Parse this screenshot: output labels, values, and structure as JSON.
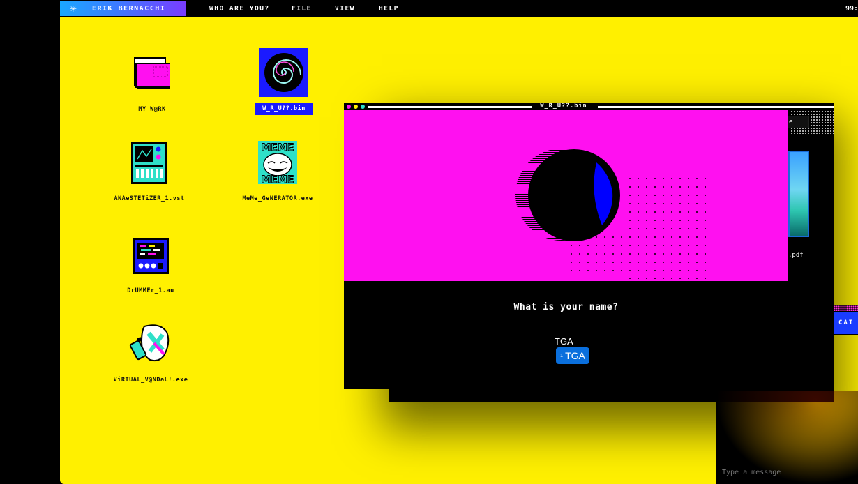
{
  "menubar": {
    "brand": "ERIK BERNACCHI",
    "items": [
      "WHO ARE YOU?",
      "FILE",
      "VIEW",
      "HELP"
    ],
    "clock": "99:"
  },
  "desktop": {
    "icons": [
      {
        "label": "MY_W@RK",
        "icon": "folder-icon"
      },
      {
        "label": "W_R_U??.bin",
        "icon": "spiral-icon",
        "selected": true
      },
      {
        "label": "ANAeSTETiZER_1.vst",
        "icon": "synth-icon"
      },
      {
        "label": "MeMe_GeNERATOR.exe",
        "icon": "meme-icon"
      },
      {
        "label": "DrUMMEr_1.au",
        "icon": "drum-machine-icon"
      },
      {
        "label": "ViRTUAL_V@NDaL!.exe",
        "icon": "spray-can-icon"
      }
    ]
  },
  "back_window": {
    "chip_text": "e",
    "file_label": ".pdf"
  },
  "front_window": {
    "title": "W_R_U??.bin",
    "question": "What is your name?",
    "answer": "TGA",
    "chip_index": "1",
    "chip_text": "TGA"
  },
  "chat": {
    "button": "CAT",
    "input_placeholder": "Type a message"
  },
  "colors": {
    "desktop": "#fff000",
    "canvas": "#ff10f0",
    "selection": "#1a1aff",
    "chip": "#0a6fdd"
  }
}
